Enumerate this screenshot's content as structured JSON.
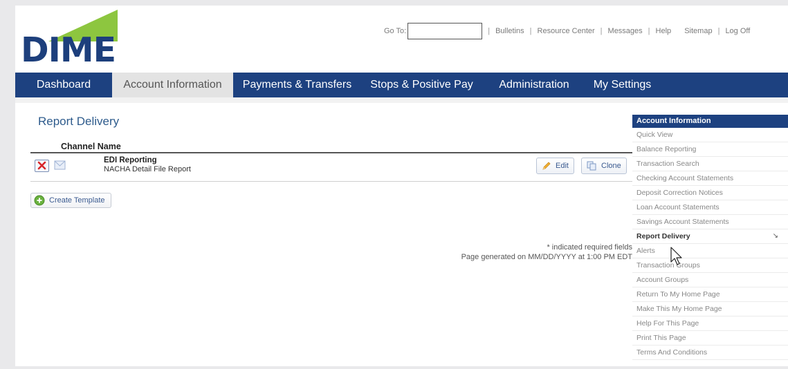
{
  "brand": {
    "name": "DIME",
    "triangle_color": "#8dc63f",
    "text_color": "#1d3f7c"
  },
  "header": {
    "goto_label": "Go To:",
    "goto_value": "",
    "links": [
      "Bulletins",
      "Resource Center",
      "Messages",
      "Help",
      "Sitemap",
      "Log Off"
    ]
  },
  "nav": {
    "items": [
      "Dashboard",
      "Account Information",
      "Payments & Transfers",
      "Stops & Positive Pay",
      "Administration",
      "My Settings"
    ],
    "active": "Account Information",
    "bar_color": "#1d4180"
  },
  "main": {
    "title": "Report Delivery",
    "column_header": "Channel Name",
    "rows": [
      {
        "name": "EDI Reporting",
        "description": "NACHA Detail File Report"
      }
    ],
    "edit_label": "Edit",
    "clone_label": "Clone",
    "create_label": "Create Template",
    "required_note": "* indicated required fields",
    "generated_note": "Page generated on MM/DD/YYYY at 1:00 PM EDT"
  },
  "sidebar": {
    "header": "Account Information",
    "items": [
      "Quick View",
      "Balance Reporting",
      "Transaction Search",
      "Checking Account Statements",
      "Deposit Correction Notices",
      "Loan Account Statements",
      "Savings Account Statements",
      "Report Delivery",
      "Alerts",
      "Transaction Groups",
      "Account Groups",
      "Return To My Home Page",
      "Make This My Home Page",
      "Help For This Page",
      "Print This Page",
      "Terms And Conditions"
    ],
    "active": "Report Delivery"
  },
  "icons": {
    "delete": "close-x-icon",
    "channel": "envelope-icon",
    "edit": "pencil-icon",
    "clone": "copy-icon",
    "create": "plus-circle-icon",
    "pointer": "mouse-pointer-icon"
  }
}
